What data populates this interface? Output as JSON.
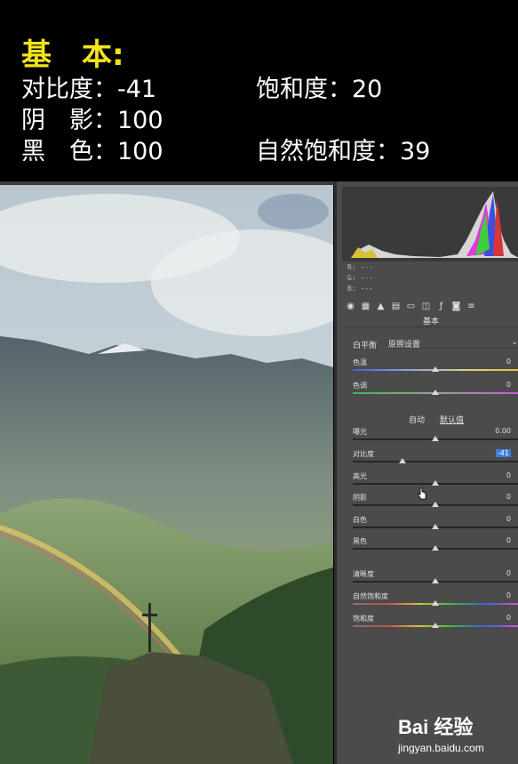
{
  "caption": {
    "title": "基　本:",
    "lines": [
      {
        "left": "对比度：-41",
        "right": "饱和度：20"
      },
      {
        "left": "阴　影：100",
        "right": ""
      },
      {
        "left": "黑　色：100",
        "right": "自然饱和度：39"
      }
    ]
  },
  "panel": {
    "rgb": {
      "r": "R: ---",
      "g": "G: ---",
      "b": "B: ---"
    },
    "section_title": "基本",
    "white_balance": {
      "label": "白平衡",
      "value": "原照设置"
    },
    "auto_label": "自动",
    "default_label": "默认值",
    "sliders": [
      {
        "label": "色温",
        "value": "0",
        "pos": 0.5,
        "track": "temp"
      },
      {
        "label": "色调",
        "value": "0",
        "pos": 0.5,
        "track": "tint"
      },
      {
        "label": "曝光",
        "value": "0.00",
        "pos": 0.5,
        "track": "gray"
      },
      {
        "label": "对比度",
        "value": "-41",
        "pos": 0.3,
        "track": "gray",
        "selected": true
      },
      {
        "label": "高光",
        "value": "0",
        "pos": 0.5,
        "track": "gray"
      },
      {
        "label": "阴影",
        "value": "0",
        "pos": 0.5,
        "track": "gray"
      },
      {
        "label": "白色",
        "value": "0",
        "pos": 0.5,
        "track": "gray"
      },
      {
        "label": "黑色",
        "value": "0",
        "pos": 0.5,
        "track": "gray"
      },
      {
        "label": "清晰度",
        "value": "0",
        "pos": 0.5,
        "track": "gray"
      },
      {
        "label": "自然饱和度",
        "value": "0",
        "pos": 0.5,
        "track": "vib"
      },
      {
        "label": "饱和度",
        "value": "0",
        "pos": 0.5,
        "track": "sat"
      }
    ]
  },
  "watermark": {
    "logo": "Bai 经验",
    "url": "jingyan.baidu.com"
  },
  "colors": {
    "caption_title": "#f3e31b",
    "caption_text": "#ffffff",
    "panel_bg": "#4b4b4b",
    "selected_value_bg": "#3d7bd6"
  },
  "icons": [
    "basic-icon",
    "tone-curve-icon",
    "detail-icon",
    "hsl-icon",
    "split-toning-icon",
    "lens-icon",
    "fx-icon",
    "camera-calibration-icon",
    "presets-icon"
  ]
}
